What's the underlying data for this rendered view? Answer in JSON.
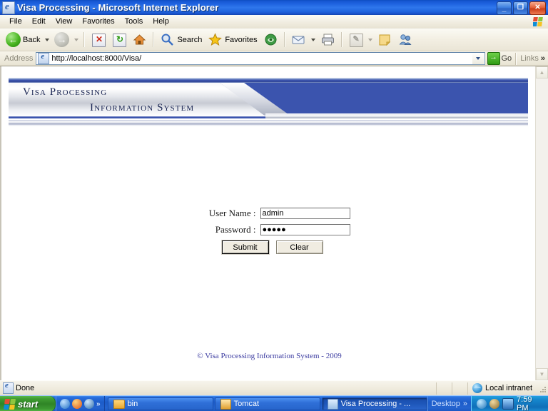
{
  "window": {
    "title": "Visa Processing - Microsoft Internet Explorer",
    "icon": "ie-document-icon",
    "minimize_label": "_",
    "restore_label": "❐",
    "close_label": "✕"
  },
  "menubar": {
    "items": [
      {
        "label": "File"
      },
      {
        "label": "Edit"
      },
      {
        "label": "View"
      },
      {
        "label": "Favorites"
      },
      {
        "label": "Tools"
      },
      {
        "label": "Help"
      }
    ]
  },
  "toolbar": {
    "back_label": "Back",
    "forward_label": "",
    "search_label": "Search",
    "favorites_label": "Favorites",
    "stop_glyph": "✕",
    "refresh_glyph": "↻",
    "home_glyph": "⌂",
    "media_glyph": "◉",
    "history_glyph": "⌚",
    "mail_glyph": "✉",
    "print_glyph": "⎙",
    "edit_glyph": "✎",
    "discuss_glyph": "▣",
    "messenger_glyph": "☻"
  },
  "address": {
    "label": "Address",
    "url": "http://localhost:8000/Visa/",
    "go_label": "Go",
    "links_label": "Links",
    "chevron": "»"
  },
  "banner": {
    "line1": "Visa Processing",
    "line2": "Information System",
    "blue": "#3b54ae",
    "text_color": "#192452"
  },
  "login": {
    "username_label": "User Name :",
    "username_value": "admin",
    "username_placeholder": "",
    "password_label": "Password :",
    "password_value": "●●●●●",
    "password_placeholder": "",
    "submit_label": "Submit",
    "clear_label": "Clear"
  },
  "footer": {
    "text": "© Visa Processing Information System - 2009"
  },
  "statusbar": {
    "status": "Done",
    "zone": "Local intranet"
  },
  "taskbar": {
    "start_label": "start",
    "quicklaunch_chevron": "»",
    "tasks": [
      {
        "label": "bin",
        "icon": "folder-icon",
        "active": false
      },
      {
        "label": "Tomcat",
        "icon": "tomcat-icon",
        "active": false
      },
      {
        "label": "Visa Processing - ...",
        "icon": "ie-icon",
        "active": true
      }
    ],
    "desktop_label": "Desktop",
    "desktop_chevron": "»",
    "clock": "7:59 PM"
  },
  "scrollbar": {
    "up_glyph": "▲",
    "down_glyph": "▼"
  }
}
